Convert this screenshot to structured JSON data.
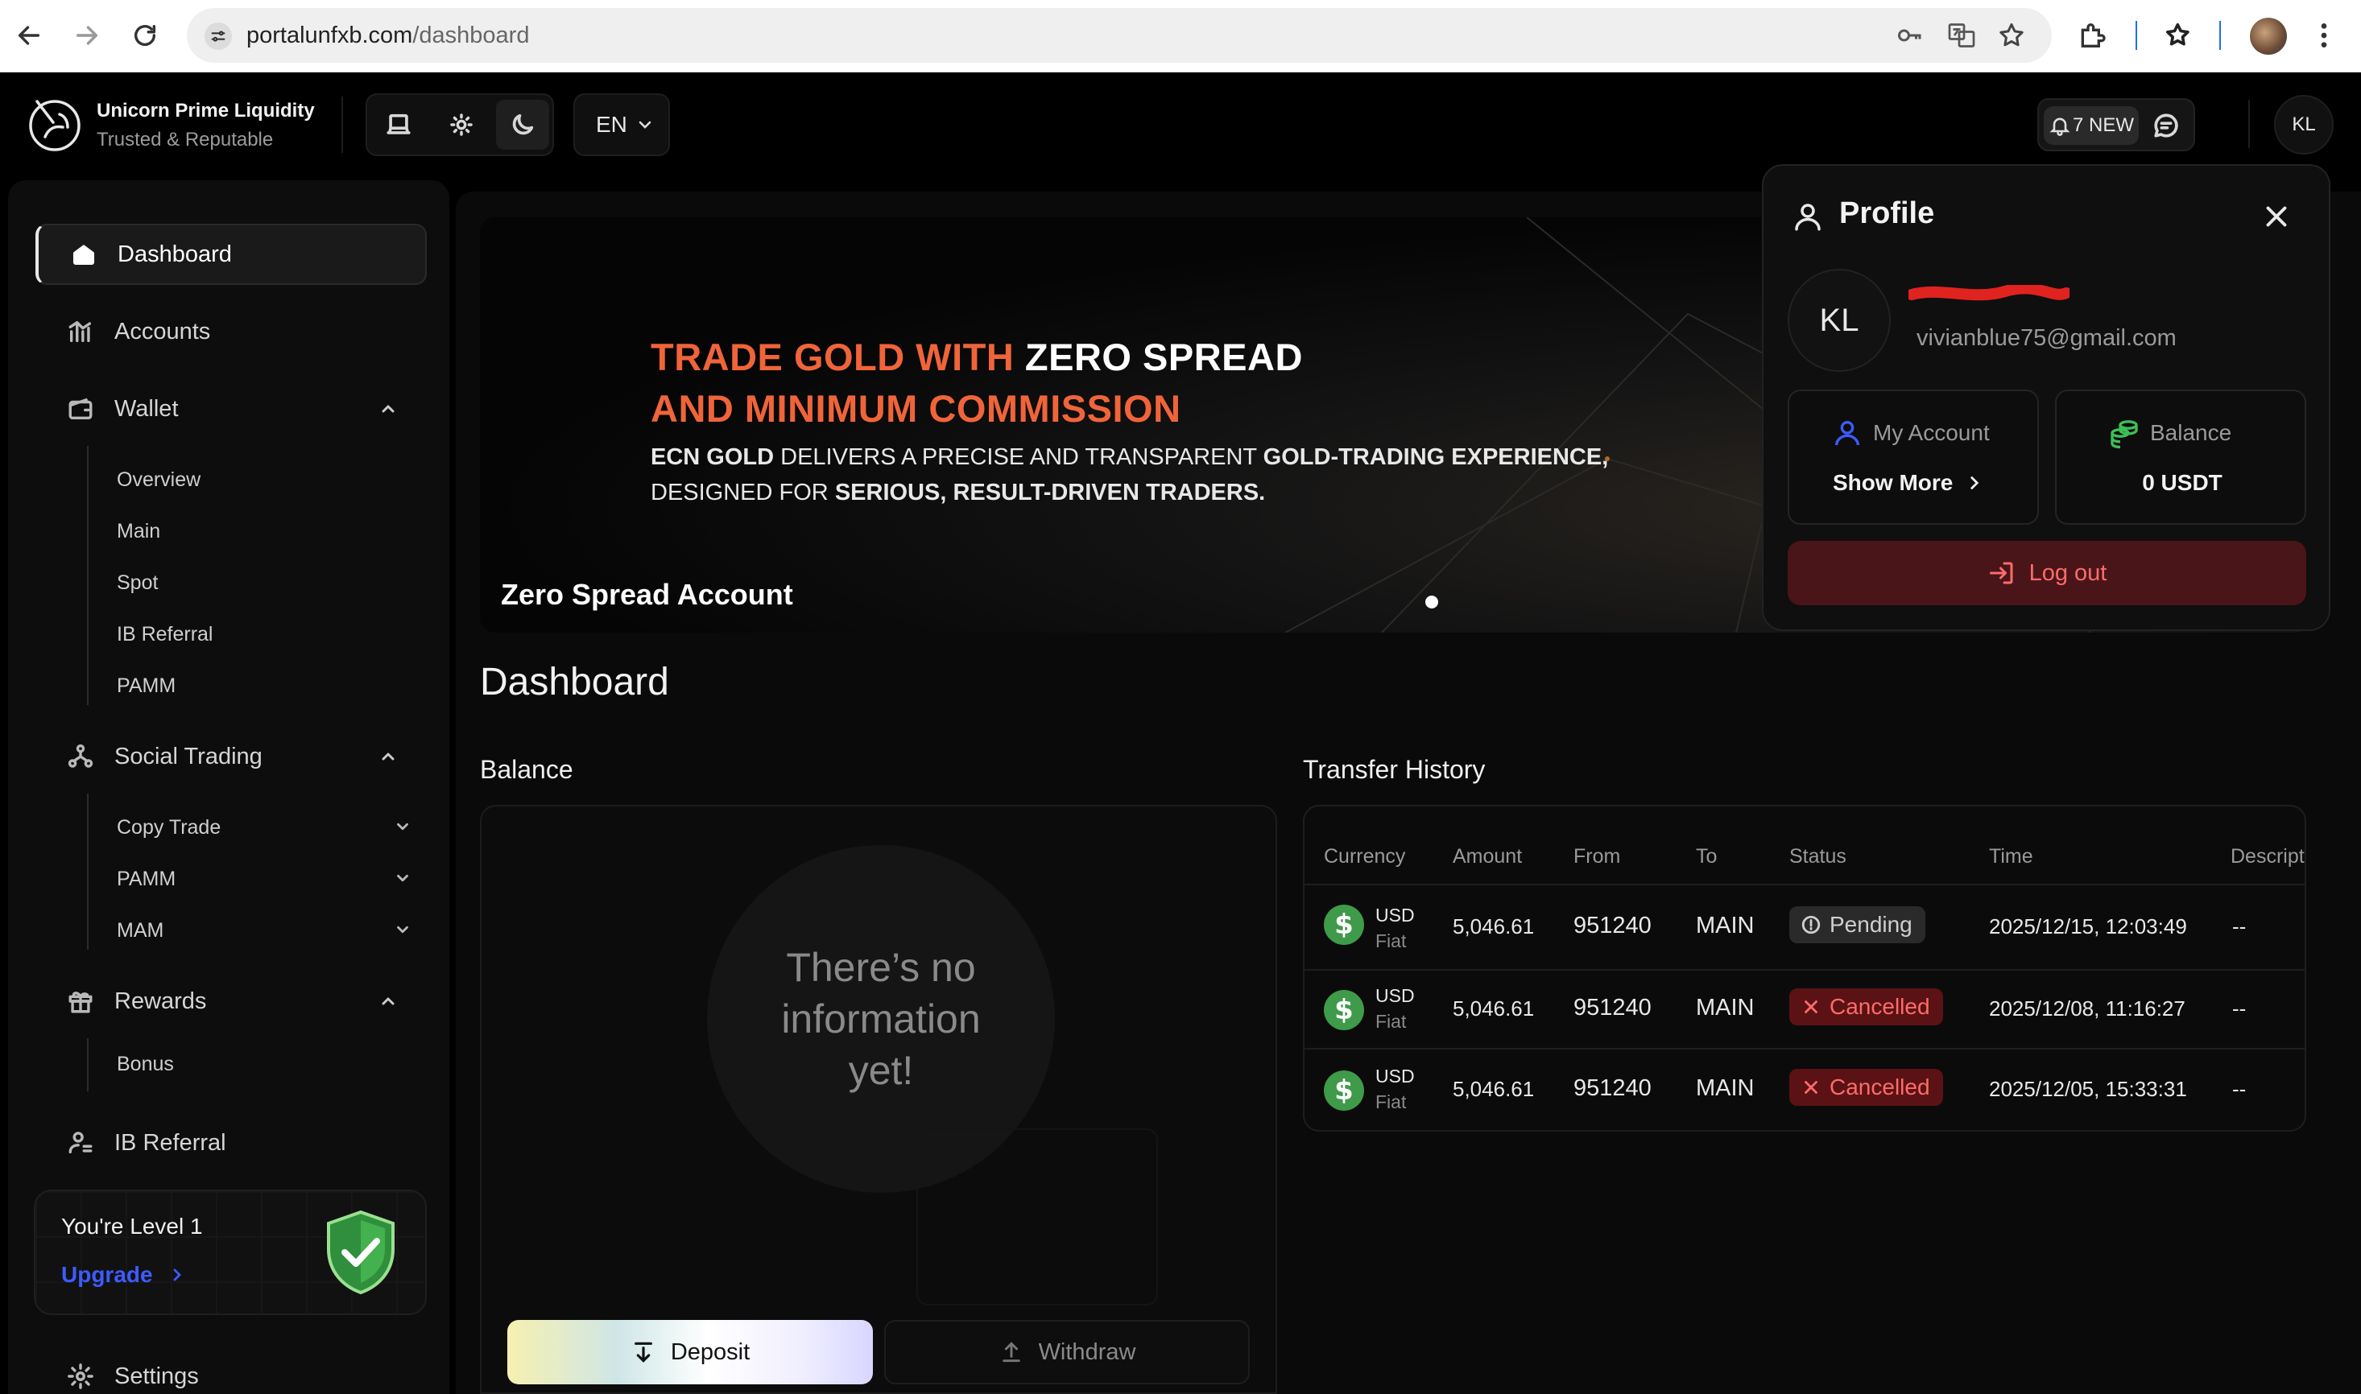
{
  "browser": {
    "url_host": "portalunfxb.com",
    "url_path": "/dashboard"
  },
  "header": {
    "brand_name": "Unicorn Prime Liquidity",
    "brand_tagline": "Trusted & Reputable",
    "language": "EN",
    "notifications": "7 NEW",
    "user_initials": "KL"
  },
  "sidebar": {
    "dashboard": "Dashboard",
    "accounts": "Accounts",
    "wallet": "Wallet",
    "wallet_items": [
      "Overview",
      "Main",
      "Spot",
      "IB Referral",
      "PAMM"
    ],
    "social_trading": "Social Trading",
    "social_items": [
      "Copy Trade",
      "PAMM",
      "MAM"
    ],
    "rewards": "Rewards",
    "rewards_items": [
      "Bonus"
    ],
    "ib_referral": "IB Referral",
    "level_text": "You're Level 1",
    "upgrade": "Upgrade",
    "settings": "Settings"
  },
  "banner": {
    "headline_orange_1": "TRADE GOLD WITH",
    "headline_white_1": "ZERO SPREAD",
    "headline_orange_2": "AND MINIMUM COMMISSION",
    "sub_bold_1": "ECN GOLD",
    "sub_1": "DELIVERS A PRECISE AND TRANSPARENT",
    "sub_bold_2": "GOLD-TRADING EXPERIENCE,",
    "sub_2": "DESIGNED FOR",
    "sub_bold_3": "SERIOUS, RESULT-DRIVEN TRADERS.",
    "caption": "Zero Spread Account"
  },
  "main": {
    "page_title": "Dashboard",
    "balance_title": "Balance",
    "empty_text": "There’s no information yet!",
    "deposit": "Deposit",
    "withdraw": "Withdraw",
    "transfer_title": "Transfer History"
  },
  "transfer": {
    "columns": [
      "Currency",
      "Amount",
      "From",
      "To",
      "Status",
      "Time",
      "Descript"
    ],
    "rows": [
      {
        "currency": "USD",
        "type": "Fiat",
        "amount": "5,046.61",
        "from": "951240",
        "to": "MAIN",
        "status": "Pending",
        "time": "2025/12/15, 12:03:49",
        "desc": "--"
      },
      {
        "currency": "USD",
        "type": "Fiat",
        "amount": "5,046.61",
        "from": "951240",
        "to": "MAIN",
        "status": "Cancelled",
        "time": "2025/12/08, 11:16:27",
        "desc": "--"
      },
      {
        "currency": "USD",
        "type": "Fiat",
        "amount": "5,046.61",
        "from": "951240",
        "to": "MAIN",
        "status": "Cancelled",
        "time": "2025/12/05, 15:33:31",
        "desc": "--"
      }
    ]
  },
  "profile": {
    "title": "Profile",
    "initials": "KL",
    "email": "vivianblue75@gmail.com",
    "my_account": "My Account",
    "show_more": "Show More",
    "balance_label": "Balance",
    "balance_value": "0 USDT",
    "logout": "Log out"
  },
  "colors": {
    "accent_orange": "#f0643a",
    "cancelled_bg": "#5a1214",
    "pending_bg": "#2a2a2a",
    "logout_bg": "#4a1518",
    "upgrade_blue": "#3d5bff"
  }
}
